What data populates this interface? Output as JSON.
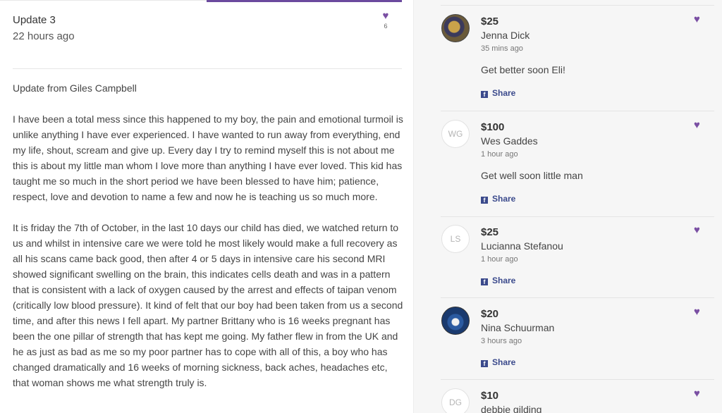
{
  "update": {
    "title": "Update 3",
    "time": "22 hours ago",
    "likes": "6",
    "heart_color": "#7a4fa3",
    "from": "Update from Giles Campbell",
    "paragraphs": [
      "I have been a total mess since this happened to my boy, the pain and emotional turmoil is unlike anything I have ever experienced. I have wanted to run away from everything, end my life, shout, scream and give up. Every day I try to remind myself this is not about me this is about my little man whom I love more than anything I have ever loved. This kid has taught me so much in the short period we have been blessed to have him; patience, respect, love and devotion to name a few and now he is teaching us so much more.",
      "It is friday the 7th of October, in the last 10 days our child has died, we watched return to us and whilst in intensive care we were told he most likely would make a full recovery as all his scans came back good, then after 4 or 5 days in intensive care his second MRI showed significant swelling on the brain, this indicates cells death and was in a pattern that is consistent with a lack of oxygen caused by the arrest and effects of taipan venom (critically low blood pressure). It kind of felt that our boy had been taken from us a second time, and after this news I fell apart. My partner Brittany who is 16 weeks pregnant has been the one pillar of strength that has kept me going. My father flew in from the UK and he as just as bad as me so my poor partner has to cope with all of this, a boy who has changed dramatically and 16 weeks of morning sickness, back aches, headaches etc, that woman shows me what strength truly is."
    ]
  },
  "donations": [
    {
      "amount": "$25",
      "name": "Jenna Dick",
      "time": "35 mins ago",
      "message": "Get better soon Eli!",
      "initials": "",
      "avatar": "photo1",
      "share": "Share"
    },
    {
      "amount": "$100",
      "name": "Wes Gaddes",
      "time": "1 hour ago",
      "message": "Get well soon little man",
      "initials": "WG",
      "avatar": "initials",
      "share": "Share"
    },
    {
      "amount": "$25",
      "name": "Lucianna Stefanou",
      "time": "1 hour ago",
      "message": "",
      "initials": "LS",
      "avatar": "initials",
      "share": "Share"
    },
    {
      "amount": "$20",
      "name": "Nina Schuurman",
      "time": "3 hours ago",
      "message": "",
      "initials": "",
      "avatar": "photo2",
      "share": "Share"
    },
    {
      "amount": "$10",
      "name": "debbie gilding",
      "time": "",
      "message": "",
      "initials": "DG",
      "avatar": "initials",
      "share": ""
    }
  ],
  "colors": {
    "accent": "#6b4a9e",
    "facebook": "#3b4a8c"
  },
  "icons": {
    "like": "heart-icon",
    "facebook": "facebook-icon"
  }
}
